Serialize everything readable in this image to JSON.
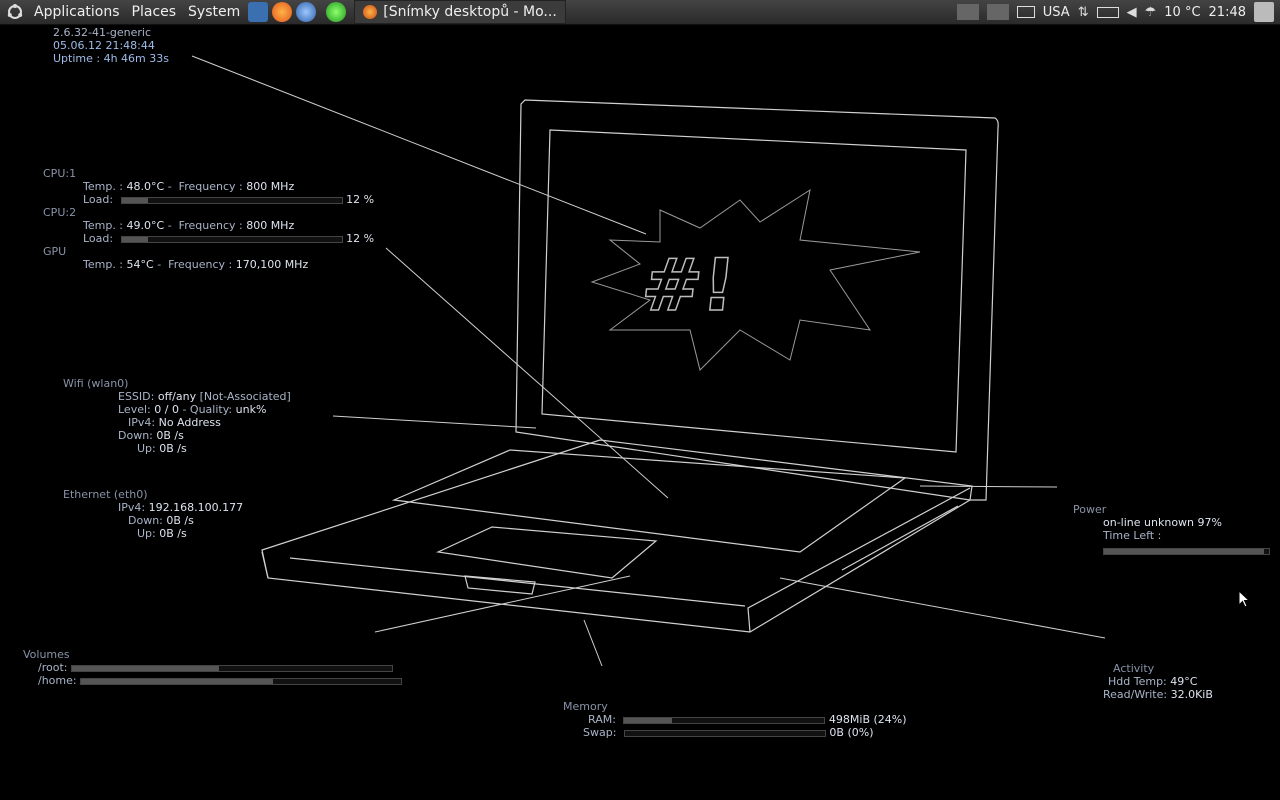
{
  "panel": {
    "menus": [
      "Applications",
      "Places",
      "System"
    ],
    "task_title": "[Snímky desktopů - Mo...",
    "kbd_layout": "USA",
    "weather": "10 °C",
    "clock": "21:48"
  },
  "system": {
    "kernel": "2.6.32-41-generic",
    "datetime": "05.06.12 21:48:44",
    "uptime": "Uptime : 4h 46m 33s"
  },
  "cpu1": {
    "header": "CPU:1",
    "temp_label": "Temp. :",
    "temp": "48.0°C",
    "freq_label": "Frequency :",
    "freq": "800 MHz",
    "load_label": "Load:",
    "load": 12,
    "load_text": "12 %"
  },
  "cpu2": {
    "header": "CPU:2",
    "temp_label": "Temp. :",
    "temp": "49.0°C",
    "freq_label": "Frequency :",
    "freq": "800 MHz",
    "load_label": "Load:",
    "load": 12,
    "load_text": "12 %"
  },
  "gpu": {
    "header": "GPU",
    "temp_label": "Temp. :",
    "temp": "54°C",
    "freq_label": "Frequency :",
    "freq": "170,100 MHz"
  },
  "wifi": {
    "header": "Wifi (wlan0)",
    "essid_label": "ESSID:",
    "essid": "off/any",
    "essid_extra": "[Not-Associated]",
    "level_label": "Level:",
    "level": "0 / 0",
    "quality_label": "- Quality:",
    "quality": "unk%",
    "ipv4_label": "IPv4:",
    "ipv4": "No Address",
    "down_label": "Down:",
    "down": "0B  /s",
    "up_label": "Up:",
    "up": "0B  /s"
  },
  "ethernet": {
    "header": "Ethernet (eth0)",
    "ipv4_label": "IPv4:",
    "ipv4": "192.168.100.177",
    "down_label": "Down:",
    "down": "0B  /s",
    "up_label": "Up:",
    "up": "0B  /s"
  },
  "power": {
    "header": "Power",
    "status": "on-line",
    "detail": "unknown 97%",
    "time_left_label": "Time Left :",
    "level": 97
  },
  "volumes": {
    "header": "Volumes",
    "root_label": "/root:",
    "root_used": 46,
    "home_label": "/home:",
    "home_used": 60
  },
  "memory": {
    "header": "Memory",
    "ram_label": "RAM:",
    "ram": "498MiB (24%)",
    "ram_used": 24,
    "swap_label": "Swap:",
    "swap": "0B  (0%)",
    "swap_used": 0
  },
  "activity": {
    "header": "Activity",
    "hdd_label": "Hdd Temp:",
    "hdd": "49°C",
    "rw_label": "Read/Write:",
    "rw": "32.0KiB"
  },
  "wallpaper": {
    "screen_text": "#!"
  },
  "colors": {
    "background": "#000000",
    "text": "#a9b4c8",
    "value": "#dde3ee",
    "line": "#cfcfcf"
  }
}
